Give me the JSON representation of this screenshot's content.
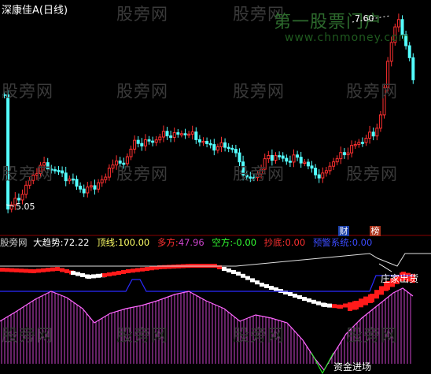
{
  "title": "深康佳A(日线)",
  "watermark_texts": [
    "股旁网",
    "第一股票门户",
    "www.chnmoney.com"
  ],
  "price_labels": {
    "high": "7.60",
    "low": "5.05"
  },
  "badges": [
    {
      "text": "财",
      "color": "#1b3fa8"
    },
    {
      "text": "榜",
      "color": "#a8331b"
    }
  ],
  "indicator": {
    "name": "股旁网",
    "trend_label": "大趋势:",
    "trend_value": "72.22",
    "top_label": "顶线:",
    "top_value": "100.00",
    "long_label": "多方:",
    "long_value": "47.96",
    "short_label": "空方:",
    "short_value": "-0.00",
    "bottom_label": "抄底:",
    "bottom_value": "0.00",
    "warn_label": "预警系统:",
    "warn_value": "0.00"
  },
  "annotations": {
    "distribution": "庄家出货",
    "inflow": "资金进场"
  },
  "colors": {
    "up": "#ff3030",
    "down": "#54ffff",
    "ma": "#ffffff",
    "histogram": "#cc44cc",
    "blue_line": "#2a2aff"
  }
}
